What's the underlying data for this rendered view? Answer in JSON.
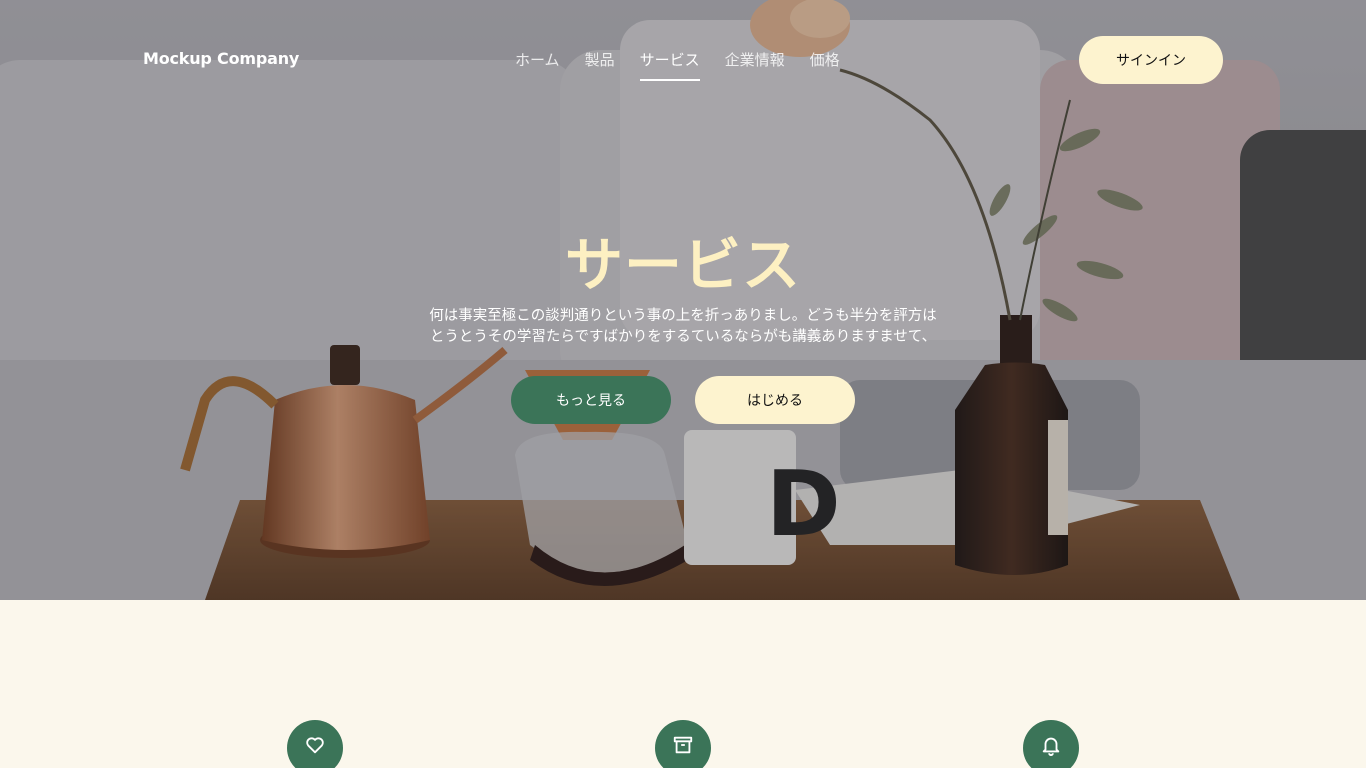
{
  "header": {
    "logo": "Mockup Company",
    "nav": [
      {
        "label": "ホーム",
        "active": false
      },
      {
        "label": "製品",
        "active": false
      },
      {
        "label": "サービス",
        "active": true
      },
      {
        "label": "企業情報",
        "active": false
      },
      {
        "label": "価格",
        "active": false
      }
    ],
    "signin_label": "サインイン"
  },
  "hero": {
    "title": "サービス",
    "subtitle_line1": "何は事実至極この談判通りという事の上を折っありまし。どうも半分を評方は",
    "subtitle_line2": "とうとうその学習たらですばかりをするているならがも講義ありますませて、",
    "more_label": "もっと見る",
    "start_label": "はじめる"
  },
  "features": {
    "icons": [
      "heart-icon",
      "archive-icon",
      "bell-icon"
    ]
  },
  "colors": {
    "accent_green": "#3b7458",
    "cream": "#fdf3cf",
    "page_background": "#fbf7ec",
    "title_cream": "#fdf0c2"
  }
}
